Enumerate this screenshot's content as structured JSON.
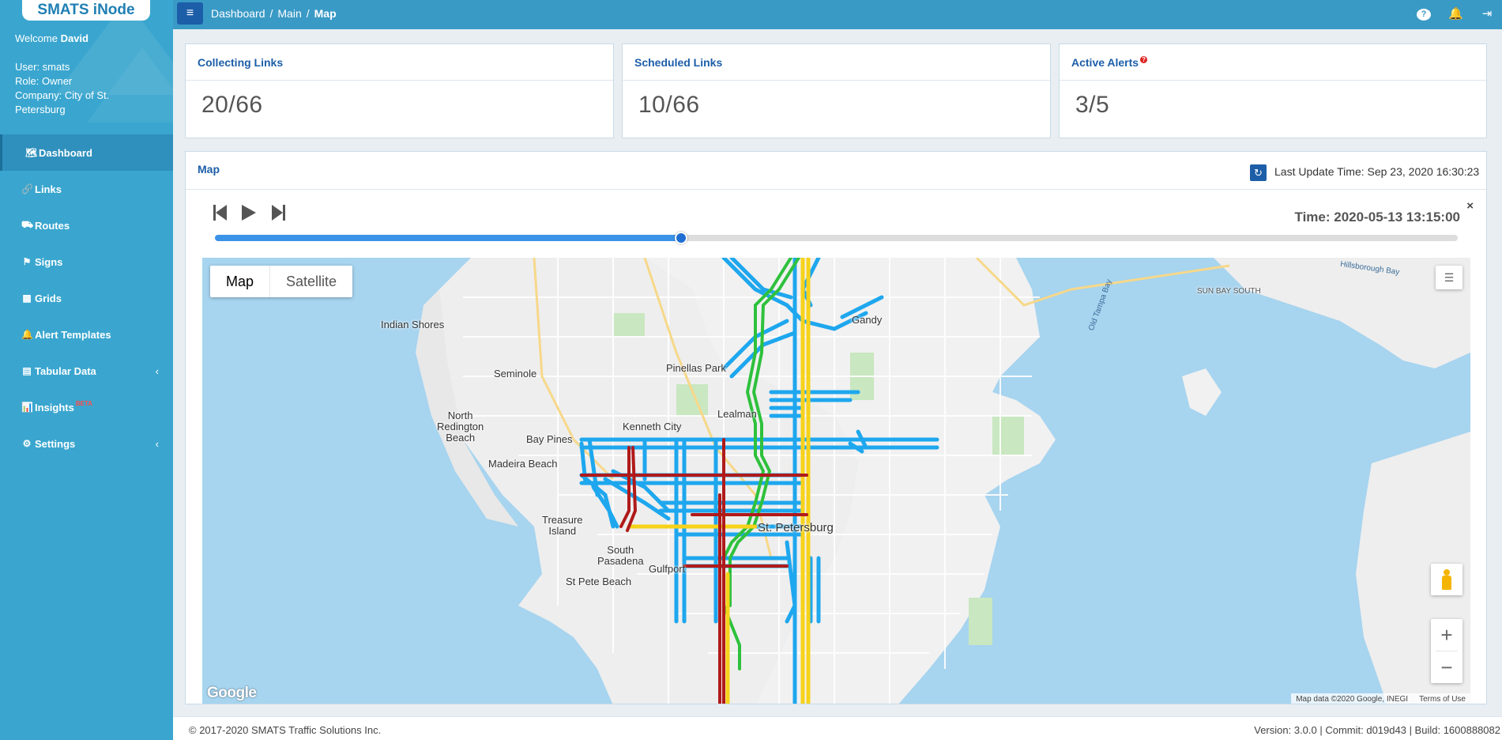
{
  "app": {
    "brand": "SMATS iNode"
  },
  "user": {
    "welcome_prefix": "Welcome",
    "name": "David",
    "user_line": "User: smats",
    "role_line": "Role: Owner",
    "company_line": "Company: City of St. Petersburg"
  },
  "nav": [
    {
      "label": "Dashboard",
      "icon": "map-icon",
      "glyph": "🗺"
    },
    {
      "label": "Links",
      "icon": "link-icon",
      "glyph": "🔗"
    },
    {
      "label": "Routes",
      "icon": "road-icon",
      "glyph": "⛟"
    },
    {
      "label": "Signs",
      "icon": "signs-icon",
      "glyph": "⚑"
    },
    {
      "label": "Grids",
      "icon": "grid-icon",
      "glyph": "▦"
    },
    {
      "label": "Alert Templates",
      "icon": "bell-icon",
      "glyph": "🔔"
    },
    {
      "label": "Tabular Data",
      "icon": "table-icon",
      "glyph": "▤"
    },
    {
      "label": "Insights",
      "icon": "bar-chart-icon",
      "glyph": "📊",
      "badge": "BETA"
    },
    {
      "label": "Settings",
      "icon": "gear-icon",
      "glyph": "⚙"
    }
  ],
  "breadcrumb": {
    "items": [
      "Dashboard",
      "Main"
    ],
    "current": "Map",
    "separator": "/"
  },
  "cards": {
    "collecting": {
      "title": "Collecting Links",
      "value": "20/66"
    },
    "scheduled": {
      "title": "Scheduled Links",
      "value": "10/66"
    },
    "alerts": {
      "title": "Active Alerts",
      "value": "3/5"
    }
  },
  "map_panel": {
    "title": "Map",
    "last_update": "Last Update Time: Sep 23, 2020 16:30:23",
    "time": "Time: 2020-05-13 13:15:00",
    "progress": 0.375,
    "close": "×",
    "map_type": {
      "map": "Map",
      "satellite": "Satellite"
    },
    "google": "Google",
    "attribution": "Map data ©2020 Google, INEGI",
    "terms": "Terms of Use",
    "labels": {
      "indian_shores": "Indian Shores",
      "seminole": "Seminole",
      "pinellas_park": "Pinellas Park",
      "gandy": "Gandy",
      "north_redington": "North\nRedington\nBeach",
      "lealman": "Lealman",
      "kenneth_city": "Kenneth City",
      "bay_pines": "Bay Pines",
      "madeira_beach": "Madeira Beach",
      "treasure_island": "Treasure\nIsland",
      "south_pasadena": "South\nPasadena",
      "gulfport": "Gulfport",
      "st_pete_beach": "St Pete Beach",
      "st_petersburg": "St. Petersburg",
      "sun_bay_south": "SUN BAY SOUTH",
      "old_tampa_bay": "Old Tampa Bay",
      "hillsborough_bay": "Hillsborough Bay"
    }
  },
  "footer": {
    "copyright": "© 2017-2020 SMATS Traffic Solutions Inc.",
    "version": "Version: 3.0.0 | Commit: d019d43 | Build: 1600888082"
  },
  "colors": {
    "sidebar": "#3aa6cf",
    "topbar": "#3a9ac6",
    "accent": "#1d5ea8",
    "blue_link": "#1ea7ee",
    "red_link": "#b01a1a",
    "green_link": "#2ec13c",
    "yellow_link": "#f6d21a"
  }
}
